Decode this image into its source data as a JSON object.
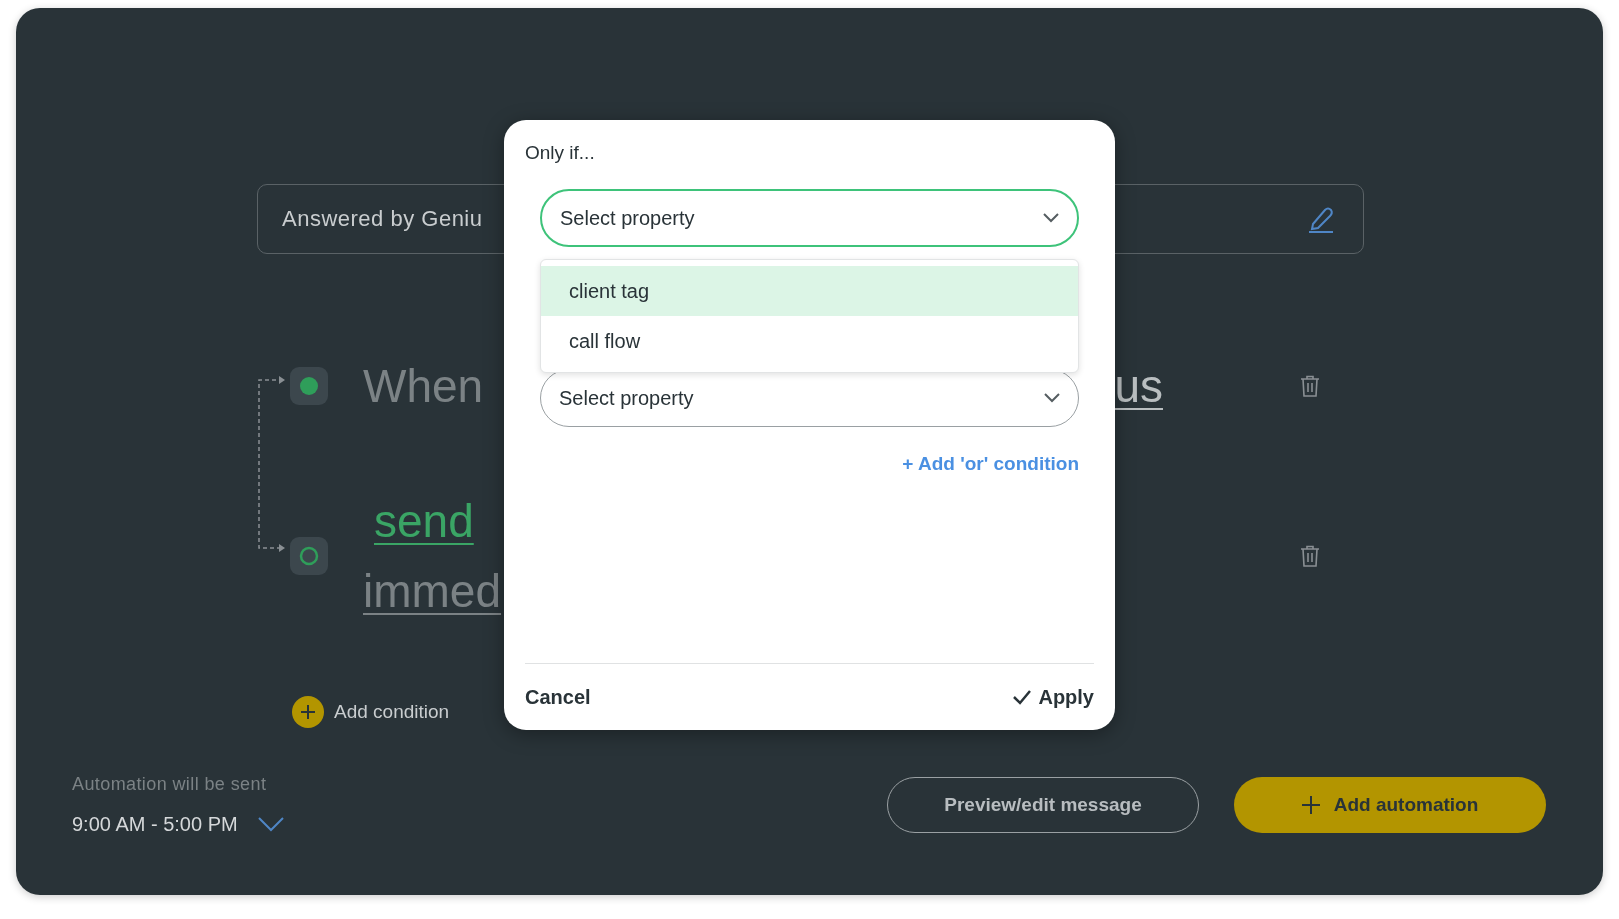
{
  "automation_field": {
    "value": "Answered by Geniu"
  },
  "steps": [
    {
      "kind": "trigger",
      "parts": [
        {
          "text": "When",
          "color": "#7b8285",
          "underline": false
        },
        {
          "text": "us",
          "color": "#b9bec0",
          "underline": true
        }
      ]
    },
    {
      "kind": "action",
      "parts": [
        {
          "text": "send",
          "color": "#3aa565",
          "underline": true
        },
        {
          "text": "immed",
          "color": "#7b8285",
          "underline": true
        }
      ]
    }
  ],
  "add_condition": "Add condition",
  "schedule": {
    "label": "Automation will be sent",
    "value": "9:00 AM - 5:00 PM"
  },
  "buttons": {
    "preview": "Preview/edit message",
    "add": "Add automation"
  },
  "modal": {
    "title": "Only if...",
    "selects": [
      {
        "label": "Select property",
        "open": true
      },
      {
        "label": "Select property",
        "open": false
      }
    ],
    "options": [
      {
        "label": "client tag",
        "selected": true
      },
      {
        "label": "call flow",
        "selected": false
      }
    ],
    "add_or": "+ Add 'or' condition",
    "cancel": "Cancel",
    "apply": "Apply"
  }
}
